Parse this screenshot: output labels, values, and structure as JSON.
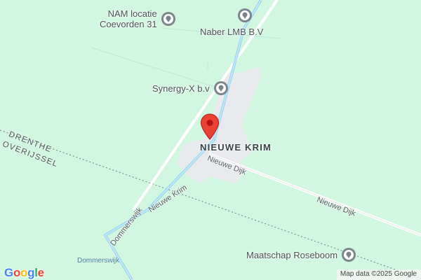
{
  "map": {
    "place_label": "NIEUWE KRIM",
    "boundary_north": "DRENTHE",
    "boundary_south": "OVERIJSSEL",
    "roads": {
      "dommerswijk": "Dommerswijk",
      "nieuwe_krim": "Nieuwe Krim",
      "nieuwe_dijk_1": "Nieuwe Dijk",
      "nieuwe_dijk_2": "Nieuwe Dijk"
    },
    "water_label": "Dommerswijk",
    "pois": [
      {
        "name_line1": "NAM locatie",
        "name_line2": "Coevorden 31",
        "icon": "place-marker-icon"
      },
      {
        "name": "Naber LMB B.V",
        "icon": "place-marker-icon"
      },
      {
        "name": "Synergy-X b.v",
        "icon": "place-marker-icon"
      },
      {
        "name": "Maatschap Roseboom",
        "icon": "place-marker-icon"
      }
    ],
    "pin_icon": "location-pin-icon",
    "colors": {
      "land": "#d2f7e0",
      "water": "#9ed6f0",
      "built_up": "#e8eaed",
      "pin": "#ea4335"
    }
  },
  "footer": {
    "logo": [
      "G",
      "o",
      "o",
      "g",
      "l",
      "e"
    ],
    "logo_colors": [
      "#4285f4",
      "#ea4335",
      "#fbbc05",
      "#4285f4",
      "#34a853",
      "#ea4335"
    ],
    "attribution": "Map data ©2025 Google"
  }
}
